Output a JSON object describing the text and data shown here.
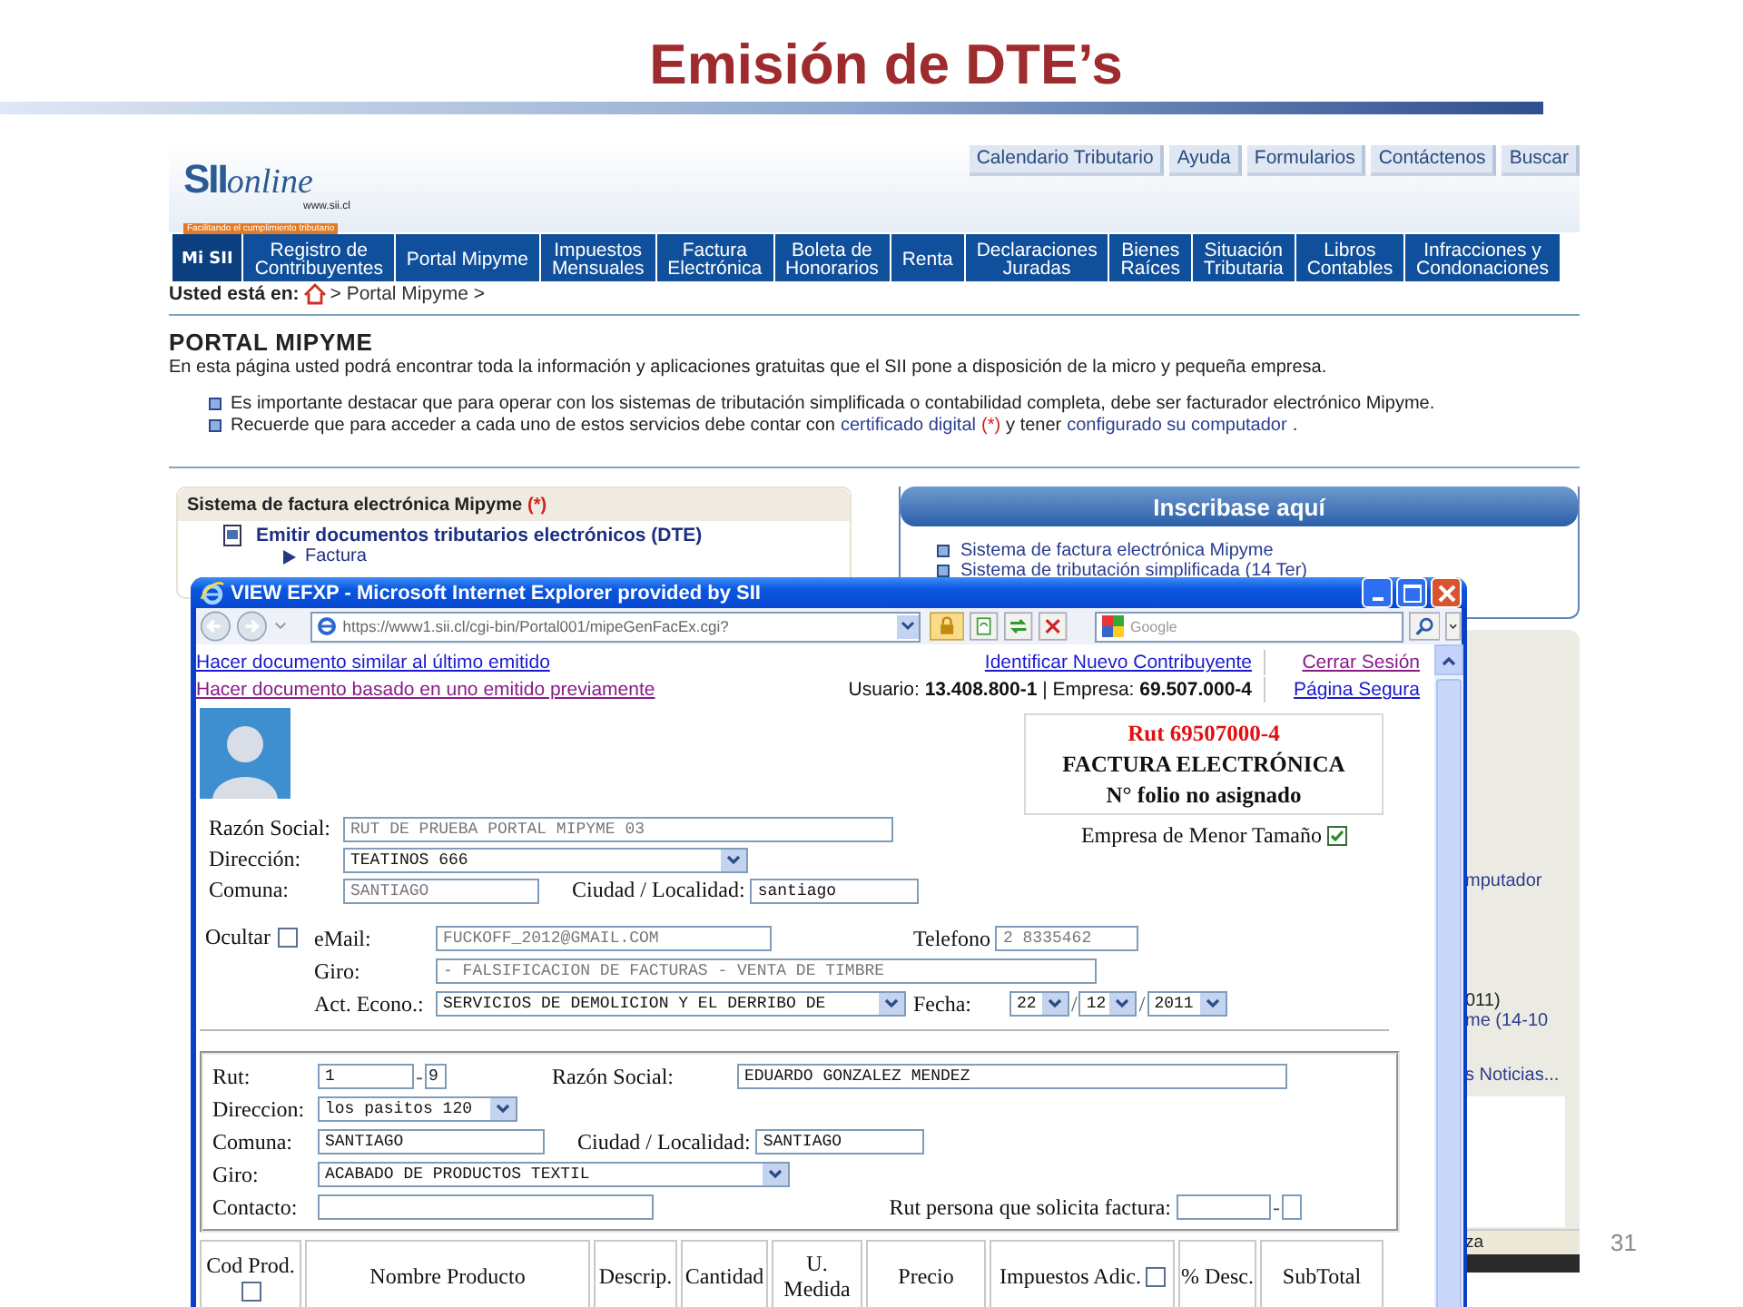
{
  "slide": {
    "title": "Emisión de DTE’s",
    "page_number": "31"
  },
  "site": {
    "logo": {
      "mark": "SII",
      "word": "online",
      "url": "www.sii.cl",
      "tagline": "Facilitando el cumplimiento tributario"
    },
    "top_links": [
      "Calendario Tributario",
      "Ayuda",
      "Formularios",
      "Contáctenos",
      "Buscar"
    ],
    "nav": [
      {
        "label": "Mi SII",
        "selected": true
      },
      {
        "label": "Registro de\nContribuyentes",
        "selected": false
      },
      {
        "label": "Portal Mipyme",
        "selected": false
      },
      {
        "label": "Impuestos\nMensuales",
        "selected": false
      },
      {
        "label": "Factura\nElectrónica",
        "selected": false
      },
      {
        "label": "Boleta de\nHonorarios",
        "selected": false
      },
      {
        "label": "Renta",
        "selected": false
      },
      {
        "label": "Declaraciones\nJuradas",
        "selected": false
      },
      {
        "label": "Bienes\nRaíces",
        "selected": false
      },
      {
        "label": "Situación\nTributaria",
        "selected": false
      },
      {
        "label": "Libros\nContables",
        "selected": false
      },
      {
        "label": "Infracciones y\nCondonaciones",
        "selected": false
      }
    ],
    "breadcrumb": {
      "label": "Usted está en:",
      "path": "> Portal Mipyme >"
    },
    "heading": "PORTAL MIPYME",
    "intro": "En esta página usted podrá encontrar toda la información y aplicaciones gratuitas que el SII pone a disposición de la micro y pequeña empresa.",
    "bullets": [
      [
        {
          "kind": "text",
          "text": "Es importante destacar que para operar con los sistemas de tributación simplificada o contabilidad completa, debe ser facturador electrónico Mipyme."
        }
      ],
      [
        {
          "kind": "text",
          "text": "Recuerde que para acceder a cada uno de estos servicios debe contar con"
        },
        {
          "kind": "link",
          "text": "certificado digital"
        },
        {
          "kind": "note",
          "text": "(*)"
        },
        {
          "kind": "text",
          "text": "y tener"
        },
        {
          "kind": "link",
          "text": "configurado su computador"
        },
        {
          "kind": "text",
          "text": "."
        }
      ]
    ],
    "left_panel": {
      "title": [
        {
          "kind": "text",
          "text": "Sistema de factura electrónica Mipyme"
        },
        {
          "kind": "note",
          "text": "(*)"
        }
      ],
      "item": "Emitir documentos tributarios electrónicos (DTE)",
      "subitem": "Factura"
    },
    "right_panel": {
      "title": "Inscribase aquí",
      "items": [
        "Sistema de factura electrónica Mipyme",
        "Sistema de tributación simplificada (14 Ter)"
      ]
    },
    "side_fragments": [
      {
        "kind": "link",
        "text": "mputador"
      },
      {
        "kind": "text",
        "text": "011)"
      },
      {
        "kind": "link",
        "text": "me (14-10"
      },
      {
        "kind": "link",
        "text": "s Noticias..."
      }
    ],
    "status_fragment": "za"
  },
  "popup": {
    "title": "VIEW EFXP - Microsoft Internet Explorer provided by SII",
    "url": "https://www1.sii.cl/cgi-bin/Portal001/mipeGenFacEx.cgi?",
    "search_placeholder": "Google",
    "left_links": [
      {
        "text": "Hacer documento similar al último emitido",
        "visited": false
      },
      {
        "text": "Hacer documento basado en uno emitido previamente",
        "visited": true
      }
    ],
    "session": {
      "identify": "Identificar Nuevo Contribuyente",
      "logout": "Cerrar Sesión",
      "user": "Usuario: **13.408.800-1** | Empresa: **69.507.000-4**",
      "secure": "Página Segura"
    },
    "doc_box": {
      "rut": "Rut 69507000-4",
      "type": "FACTURA ELECTRÓNICA",
      "folio": "N° folio no asignado"
    },
    "issuer": {
      "razon_social": {
        "label": "Razón Social:",
        "value": "RUT DE PRUEBA PORTAL MIPYME 03",
        "disabled": true
      },
      "direccion": {
        "label": "Dirección:",
        "value": "TEATINOS 666"
      },
      "comuna": {
        "label": "Comuna:",
        "value": "SANTIAGO",
        "disabled": true
      },
      "ciudad": {
        "label": "Ciudad / Localidad:",
        "value": "santiago",
        "disabled": false
      },
      "menor_tamano": {
        "label": "Empresa de Menor Tamaño",
        "checked": true
      },
      "ocultar": {
        "label": "Ocultar",
        "checked": false
      },
      "email": {
        "label": "eMail:",
        "value": "FUCKOFF_2012@GMAIL.COM",
        "disabled": true
      },
      "telefono": {
        "label": "Telefono",
        "value": "2 8335462",
        "disabled": true
      },
      "giro": {
        "label": "Giro:",
        "value": "- FALSIFICACION DE FACTURAS - VENTA DE TIMBRE",
        "disabled": true
      },
      "act_econo": {
        "label": "Act. Econo.:",
        "value": "SERVICIOS DE DEMOLICION Y EL DERRIBO DE"
      },
      "fecha": {
        "label": "Fecha:",
        "day": "22",
        "month": "12",
        "year": "2011",
        "separators": [
          "/",
          "/"
        ]
      }
    },
    "receiver": {
      "rut": {
        "label": "Rut:",
        "number": "1",
        "dash": "-",
        "dv": "9"
      },
      "razon_social": {
        "label": "Razón Social:",
        "value": "EDUARDO GONZALEZ MENDEZ"
      },
      "direccion": {
        "label": "Direccion:",
        "value": "los pasitos 120"
      },
      "comuna": {
        "label": "Comuna:",
        "value": "SANTIAGO"
      },
      "ciudad": {
        "label": "Ciudad / Localidad:",
        "value": "SANTIAGO"
      },
      "giro": {
        "label": "Giro:",
        "value": "ACABADO DE PRODUCTOS TEXTIL"
      },
      "contacto": {
        "label": "Contacto:"
      },
      "solicitante": {
        "label": "Rut persona que solicita factura:",
        "dash": "-"
      }
    },
    "items_columns": [
      {
        "label": "Cod Prod.",
        "kind": "checkbox_below",
        "checked": false
      },
      {
        "label": "Nombre Producto",
        "kind": "plain"
      },
      {
        "label": "Descrip.",
        "kind": "plain"
      },
      {
        "label": "Cantidad",
        "kind": "plain"
      },
      {
        "label": "U. Medida",
        "kind": "plain"
      },
      {
        "label": "Precio",
        "kind": "plain"
      },
      {
        "label": "Impuestos Adic.",
        "kind": "checkbox_inline",
        "checked": false
      },
      {
        "label": "% Desc.",
        "kind": "plain"
      },
      {
        "label": "SubTotal",
        "kind": "plain"
      }
    ]
  }
}
